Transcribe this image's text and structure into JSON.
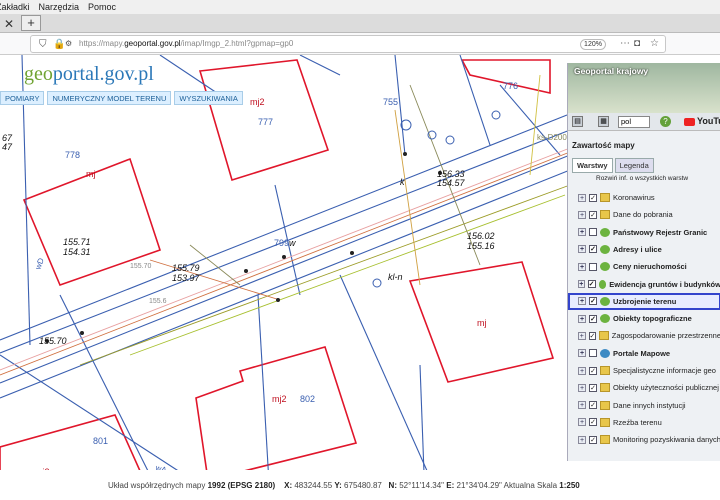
{
  "browser": {
    "menu": [
      "Zakładki",
      "Narzędzia",
      "Pomoc"
    ],
    "url_prefix": "https://mapy.",
    "url_domain": "geoportal.gov.pl",
    "url_path": "/imap/Imgp_2.html?gpmap=gp0",
    "zoom": "120%"
  },
  "site": {
    "logo_a": "geo",
    "logo_b": "portal.gov.pl",
    "menu": [
      "POMIARY",
      "NUMERYCZNY MODEL TERENU",
      "WYSZUKIWANIA"
    ]
  },
  "map": {
    "labels": [
      "mj2",
      "777",
      "755",
      "776",
      "778",
      "mj",
      "156.33",
      "154.57",
      "k",
      "155.71",
      "154.31",
      "799",
      "w",
      "156.02",
      "155.16",
      "155.79",
      "153.97",
      "kl-n",
      "155.70",
      "mj",
      "mj2",
      "802",
      "801",
      "mj2",
      "wD",
      "wA",
      "67",
      "47",
      "ks-D200",
      "155.6",
      "155.70"
    ]
  },
  "panel": {
    "title": "Geoportal krajowy",
    "lang": "pol",
    "youtube": "YouTu",
    "content_title": "Zawartość mapy",
    "tabs": [
      "Warstwy",
      "Legenda"
    ],
    "expand_all": "Rozwiń inf. o wszystkich warstw",
    "layers": [
      {
        "label": "Koronawirus",
        "icon": "folder",
        "bold": false,
        "checked": true
      },
      {
        "label": "Dane do pobrania",
        "icon": "folder",
        "bold": false,
        "checked": true
      },
      {
        "label": "Państwowy Rejestr Granic",
        "icon": "green",
        "bold": true,
        "checked": false
      },
      {
        "label": "Adresy i ulice",
        "icon": "green",
        "bold": true,
        "checked": true
      },
      {
        "label": "Ceny nieruchomości",
        "icon": "green",
        "bold": true,
        "checked": false
      },
      {
        "label": "Ewidencja gruntów i budynków",
        "icon": "green",
        "bold": true,
        "checked": true
      },
      {
        "label": "Uzbrojenie terenu",
        "icon": "green",
        "bold": true,
        "checked": true,
        "selected": true
      },
      {
        "label": "Obiekty topograficzne",
        "icon": "green",
        "bold": true,
        "checked": true
      },
      {
        "label": "Zagospodarowanie przestrzenne",
        "icon": "folder",
        "bold": false,
        "checked": true
      },
      {
        "label": "Portale Mapowe",
        "icon": "globe",
        "bold": true,
        "checked": false
      },
      {
        "label": "Specjalistyczne informacje geo",
        "icon": "folder",
        "bold": false,
        "checked": true
      },
      {
        "label": "Obiekty użyteczności publicznej",
        "icon": "folder",
        "bold": false,
        "checked": true
      },
      {
        "label": "Dane innych instytucji",
        "icon": "folder",
        "bold": false,
        "checked": true
      },
      {
        "label": "Rzeźba terenu",
        "icon": "folder",
        "bold": false,
        "checked": true
      },
      {
        "label": "Monitoring pozyskiwania danych",
        "icon": "folder",
        "bold": false,
        "checked": true
      }
    ]
  },
  "status": {
    "text1": "Układ współrzędnych mapy",
    "crs": "1992 (EPSG 2180)",
    "x_label": "X:",
    "x": "483244.55",
    "y_label": "Y:",
    "y": "675480.87",
    "n_label": "N:",
    "n": "52°11'14.34\"",
    "e_label": "E:",
    "e": "21°34'04.29\"",
    "scale_label": "Aktualna Skala",
    "scale": "1:250"
  }
}
